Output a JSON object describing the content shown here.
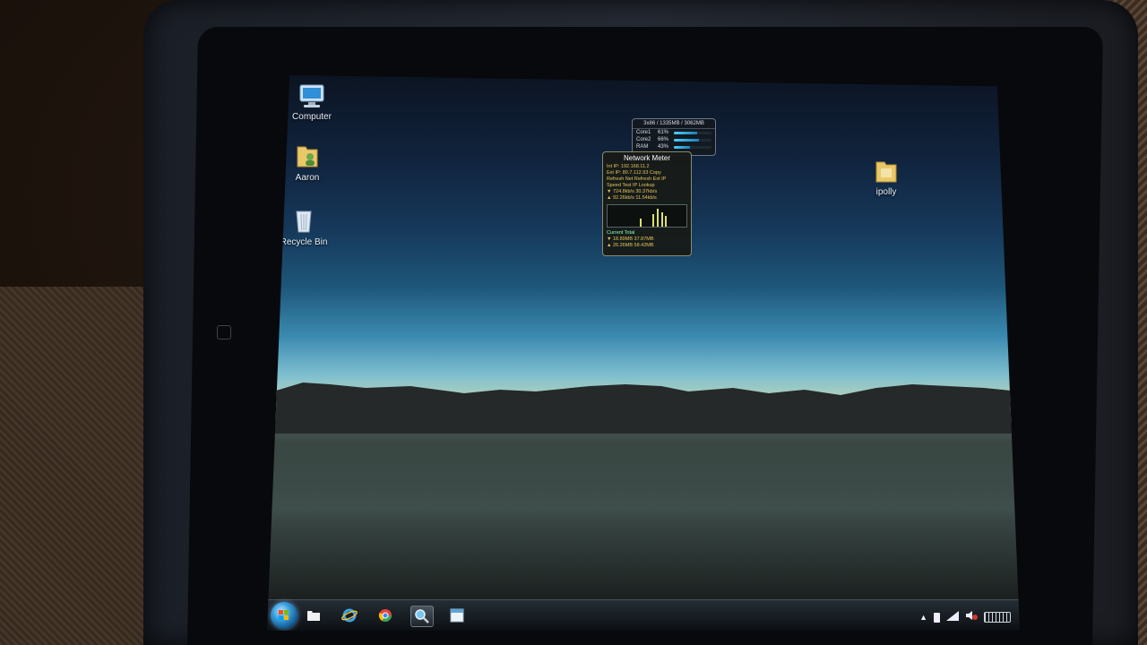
{
  "desktop": {
    "icons": [
      {
        "label": "Computer",
        "icon": "computer-icon"
      },
      {
        "label": "Aaron",
        "icon": "user-folder-icon"
      },
      {
        "label": "Recycle Bin",
        "icon": "recycle-bin-icon"
      },
      {
        "label": "ipolly",
        "icon": "folder-icon"
      }
    ]
  },
  "cpu_gadget": {
    "header": "3x86 / 1335MB / 3062MB",
    "rows": [
      {
        "label": "Core1",
        "value": "61%",
        "level": 0.61
      },
      {
        "label": "Core2",
        "value": "66%",
        "level": 0.66
      },
      {
        "label": "RAM",
        "value": "43%",
        "level": 0.43
      }
    ]
  },
  "network_gadget": {
    "title": "Network Meter",
    "lines": [
      "Int IP: 192.168.11.2",
      "Ext IP: 80.7.112.93    Copy",
      "Refresh Net    Refresh Ext IP",
      "Speed Test     IP Lookup",
      "▼ 724.8kb/s    30.37kb/s",
      "▲ 92.26kb/s    11.54kb/s"
    ],
    "totals_header": "Current     Total",
    "totals": [
      "▼ 18.89MB     37.87MB",
      "▲ 26.26MB     58.42MB"
    ]
  },
  "taskbar": {
    "items": [
      {
        "name": "start-orb",
        "icon": "windows-logo-icon"
      },
      {
        "name": "taskbar-item-explorer",
        "icon": "folder-icon"
      },
      {
        "name": "taskbar-item-ie",
        "icon": "internet-explorer-icon"
      },
      {
        "name": "taskbar-item-chrome",
        "icon": "chrome-icon"
      },
      {
        "name": "taskbar-item-search",
        "icon": "magnifier-icon"
      },
      {
        "name": "taskbar-item-window",
        "icon": "window-icon"
      }
    ],
    "tray": [
      "show-hidden-icons",
      "battery-icon",
      "network-signal-icon",
      "volume-icon",
      "touch-keyboard-icon"
    ]
  }
}
